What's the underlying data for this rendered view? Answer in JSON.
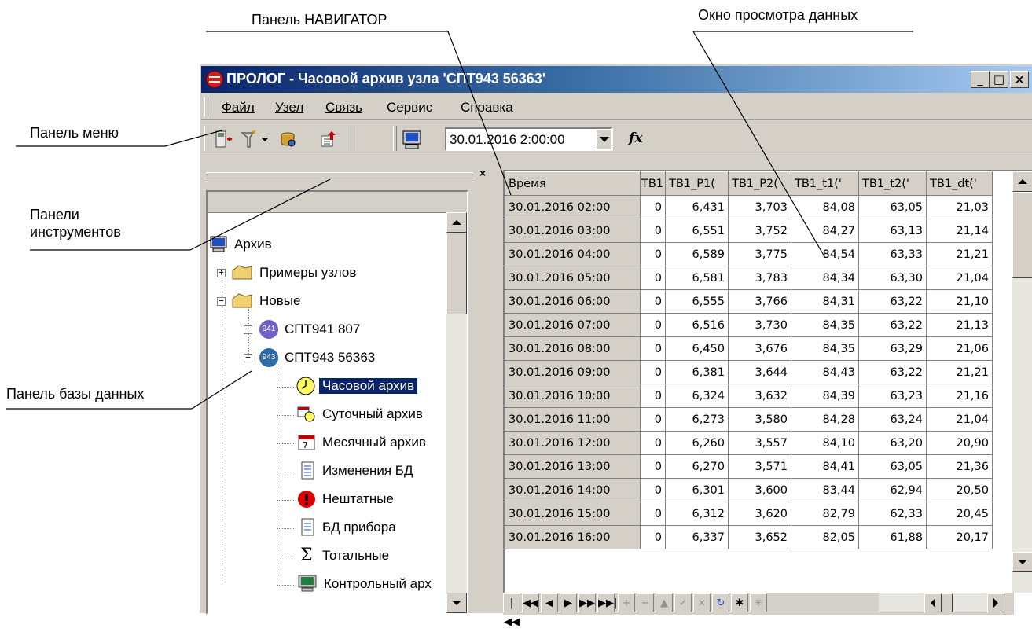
{
  "callouts": {
    "navigator": "Панель НАВИГАТОР",
    "data_view": "Окно просмотра данных",
    "menu": "Панель меню",
    "toolbars": "Панели\nинструментов",
    "database": "Панель базы данных"
  },
  "window": {
    "title": "ПРОЛОГ - Часовой архив узла 'СПТ943 56363'",
    "minimize": "_",
    "maximize": "□",
    "close": "×"
  },
  "menu": {
    "file": "Файл",
    "node": "Узел",
    "link": "Связь",
    "service": "Сервис",
    "help": "Справка"
  },
  "toolbar": {
    "date_value": "30.01.2016 2:00:00",
    "fx_label": "fx"
  },
  "dbpanel": {
    "close": "×"
  },
  "tree": {
    "archive": "Архив",
    "examples": "Примеры узлов",
    "new": "Новые",
    "spt941": "СПТ941 807",
    "spt943": "СПТ943 56363",
    "hourly": "Часовой архив",
    "daily": "Суточный архив",
    "monthly": "Месячный архив",
    "db_changes": "Изменения БД",
    "abnormal": "Нештатные",
    "device_db": "БД прибора",
    "totals": "Тотальные",
    "control": "Контрольный арх",
    "badge941": "941",
    "badge943": "943"
  },
  "grid": {
    "headers": [
      "Время",
      "ТВ1",
      "ТВ1_Р1(",
      "ТВ1_Р2(",
      "ТВ1_t1('",
      "ТВ1_t2('",
      "ТВ1_dt('"
    ],
    "rows": [
      [
        "30.01.2016 02:00",
        "0",
        "6,431",
        "3,703",
        "84,08",
        "63,05",
        "21,03"
      ],
      [
        "30.01.2016 03:00",
        "0",
        "6,551",
        "3,752",
        "84,27",
        "63,13",
        "21,14"
      ],
      [
        "30.01.2016 04:00",
        "0",
        "6,589",
        "3,775",
        "84,54",
        "63,33",
        "21,21"
      ],
      [
        "30.01.2016 05:00",
        "0",
        "6,581",
        "3,783",
        "84,34",
        "63,30",
        "21,04"
      ],
      [
        "30.01.2016 06:00",
        "0",
        "6,555",
        "3,766",
        "84,31",
        "63,22",
        "21,10"
      ],
      [
        "30.01.2016 07:00",
        "0",
        "6,516",
        "3,730",
        "84,35",
        "63,22",
        "21,13"
      ],
      [
        "30.01.2016 08:00",
        "0",
        "6,450",
        "3,676",
        "84,35",
        "63,29",
        "21,06"
      ],
      [
        "30.01.2016 09:00",
        "0",
        "6,381",
        "3,644",
        "84,43",
        "63,22",
        "21,21"
      ],
      [
        "30.01.2016 10:00",
        "0",
        "6,324",
        "3,632",
        "84,39",
        "63,23",
        "21,16"
      ],
      [
        "30.01.2016 11:00",
        "0",
        "6,273",
        "3,580",
        "84,28",
        "63,24",
        "21,04"
      ],
      [
        "30.01.2016 12:00",
        "0",
        "6,260",
        "3,557",
        "84,10",
        "63,20",
        "20,90"
      ],
      [
        "30.01.2016 13:00",
        "0",
        "6,270",
        "3,571",
        "84,41",
        "63,05",
        "21,36"
      ],
      [
        "30.01.2016 14:00",
        "0",
        "6,301",
        "3,600",
        "83,44",
        "62,94",
        "20,50"
      ],
      [
        "30.01.2016 15:00",
        "0",
        "6,312",
        "3,620",
        "82,79",
        "62,33",
        "20,45"
      ],
      [
        "30.01.2016 16:00",
        "0",
        "6,337",
        "3,652",
        "82,05",
        "61,88",
        "20,17"
      ]
    ]
  },
  "navigator": {
    "first": "|◀◀",
    "prior_page": "◀◀",
    "prior": "◀",
    "next": "▶",
    "next_page": "▶▶",
    "last": "▶▶|",
    "insert": "+",
    "delete": "−",
    "edit": "▲",
    "post": "✓",
    "cancel": "×",
    "refresh": "↻",
    "apply": "✱",
    "cancel_updates": "✳"
  }
}
